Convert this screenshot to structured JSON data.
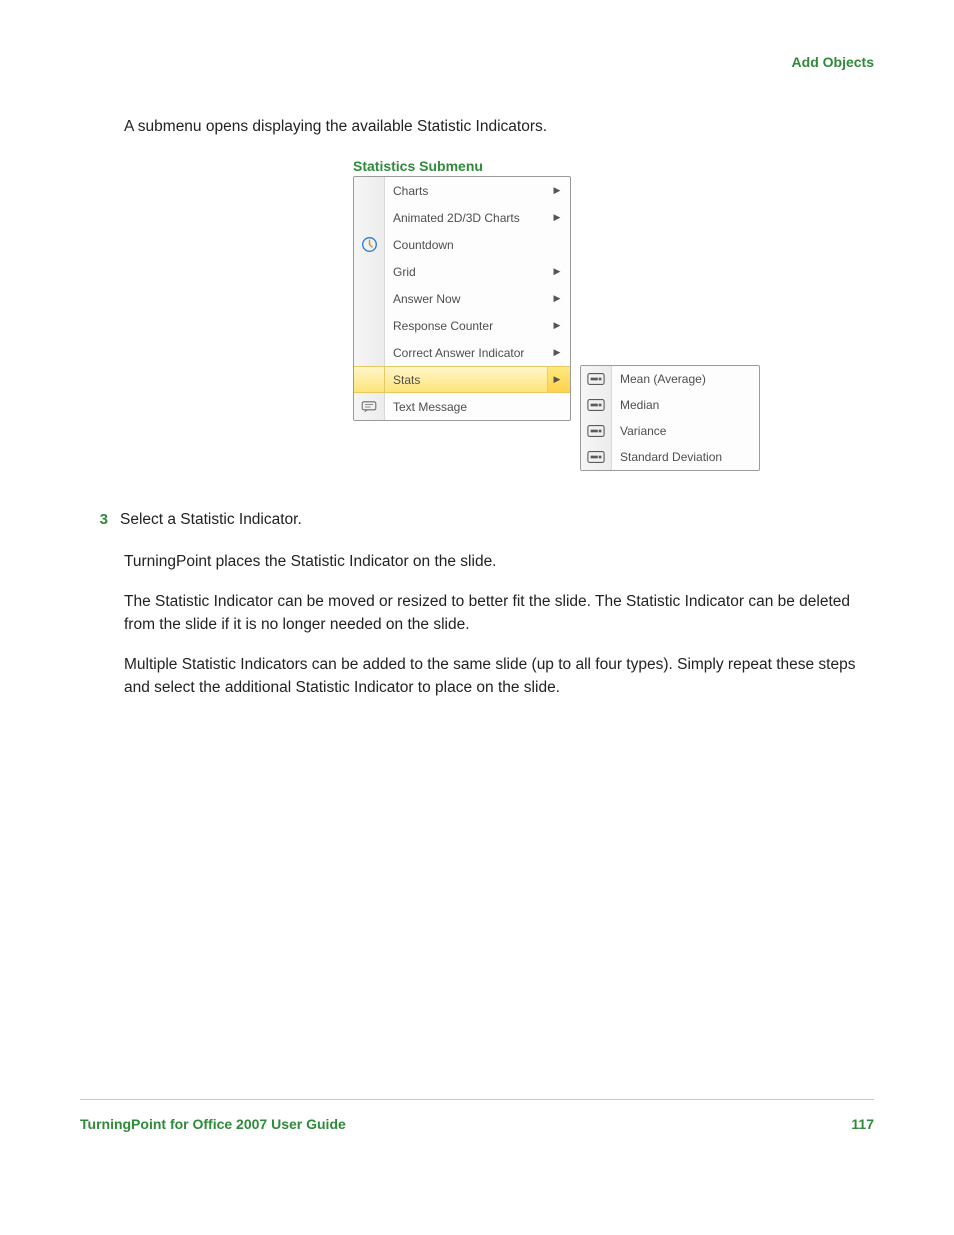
{
  "header": {
    "section": "Add Objects"
  },
  "intro": "A submenu opens displaying the available Statistic Indicators.",
  "figure": {
    "caption": "Statistics Submenu",
    "menu_items": [
      {
        "label": "Charts",
        "has_arrow": true,
        "icon": ""
      },
      {
        "label": "Animated 2D/3D Charts",
        "has_arrow": true,
        "icon": ""
      },
      {
        "label": "Countdown",
        "has_arrow": false,
        "icon": "clock"
      },
      {
        "label": "Grid",
        "has_arrow": true,
        "icon": ""
      },
      {
        "label": "Answer Now",
        "has_arrow": true,
        "icon": ""
      },
      {
        "label": "Response Counter",
        "has_arrow": true,
        "icon": ""
      },
      {
        "label": "Correct Answer Indicator",
        "has_arrow": true,
        "icon": ""
      },
      {
        "label": "Stats",
        "has_arrow": true,
        "icon": "",
        "highlight": true
      },
      {
        "label": "Text Message",
        "has_arrow": false,
        "icon": "text-msg"
      }
    ],
    "submenu_items": [
      {
        "label": "Mean (Average)"
      },
      {
        "label": "Median"
      },
      {
        "label": "Variance"
      },
      {
        "label": "Standard Deviation"
      }
    ]
  },
  "step": {
    "number": "3",
    "text": "Select a Statistic Indicator."
  },
  "paragraphs": [
    "TurningPoint places the Statistic Indicator on the slide.",
    "The Statistic Indicator can be moved or resized to better fit the slide. The Statistic Indicator can be deleted from the slide if it is no longer needed on the slide.",
    "Multiple Statistic Indicators can be added to the same slide (up to all four types). Simply repeat these steps and select the additional Statistic Indicator to place on the slide."
  ],
  "footer": {
    "left": "TurningPoint for Office 2007 User Guide",
    "right": "117"
  }
}
